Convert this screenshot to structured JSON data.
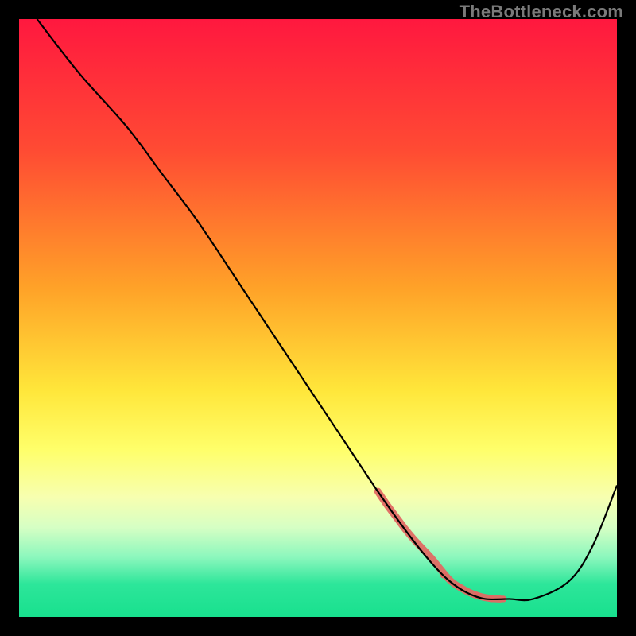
{
  "watermark": "TheBottleneck.com",
  "chart_data": {
    "type": "line",
    "title": "",
    "xlabel": "",
    "ylabel": "",
    "xlim": [
      0,
      100
    ],
    "ylim": [
      0,
      100
    ],
    "grid": false,
    "legend": false,
    "background_gradient_stops": [
      {
        "offset": 0.0,
        "color": "#ff183f"
      },
      {
        "offset": 0.22,
        "color": "#ff4b33"
      },
      {
        "offset": 0.45,
        "color": "#ffa228"
      },
      {
        "offset": 0.62,
        "color": "#ffe63a"
      },
      {
        "offset": 0.72,
        "color": "#ffff6a"
      },
      {
        "offset": 0.8,
        "color": "#f7ffb0"
      },
      {
        "offset": 0.85,
        "color": "#d6ffc4"
      },
      {
        "offset": 0.9,
        "color": "#8cf7bd"
      },
      {
        "offset": 0.945,
        "color": "#2de69a"
      },
      {
        "offset": 1.0,
        "color": "#18e08e"
      }
    ],
    "series": [
      {
        "name": "curve",
        "stroke": "#000000",
        "stroke_width": 2.2,
        "x": [
          3,
          10,
          18,
          24,
          30,
          38,
          46,
          54,
          60,
          65,
          69,
          72,
          75,
          78,
          82,
          86,
          92,
          96,
          100
        ],
        "y": [
          100,
          91,
          82,
          74,
          66,
          54,
          42,
          30,
          21,
          14,
          9,
          6,
          4,
          3,
          3,
          3,
          6,
          12,
          22
        ]
      }
    ],
    "highlight_segment": {
      "name": "highlight",
      "stroke": "#e06a63",
      "stroke_width": 9,
      "x": [
        60,
        61.5,
        63,
        64.5,
        66,
        67.5,
        69,
        72,
        74,
        75.5,
        77.2,
        78.8,
        80.5
      ],
      "y": [
        21,
        18.8,
        16.8,
        14.8,
        13,
        11.4,
        9.8,
        6.2,
        4.8,
        4.0,
        3.4,
        3.1,
        3.0
      ]
    },
    "highlight_dots": {
      "name": "dots",
      "fill": "#e06a63",
      "r": 4.2,
      "points": [
        {
          "x": 71.0,
          "y": 7.0
        },
        {
          "x": 73.5,
          "y": 5.1
        },
        {
          "x": 76.5,
          "y": 3.6
        },
        {
          "x": 79.0,
          "y": 3.0
        },
        {
          "x": 81.0,
          "y": 3.0
        }
      ]
    }
  }
}
